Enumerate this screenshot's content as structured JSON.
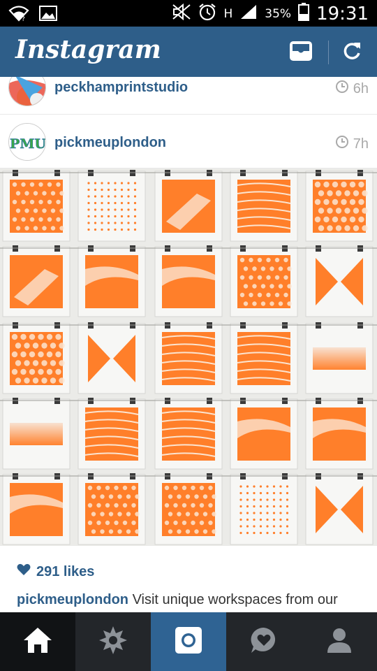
{
  "status_bar": {
    "battery": "35%",
    "network": "H",
    "time": "19:31",
    "icons": [
      "wifi-icon",
      "image-icon",
      "mute-icon",
      "alarm-icon",
      "signal-icon",
      "battery-icon"
    ]
  },
  "header": {
    "title": "Instagram",
    "actions": [
      "inbox-icon",
      "refresh-icon"
    ]
  },
  "feed": {
    "posts": [
      {
        "username": "peckhamprintstudio",
        "time": "6h"
      },
      {
        "username": "pickmeuplondon",
        "time": "7h",
        "avatar_text": "PMU",
        "likes": "291 likes",
        "caption_user": "pickmeuplondon",
        "caption_text": "Visit unique workspaces from our"
      }
    ]
  },
  "colors": {
    "accent": "#2e5e89",
    "print_orange": "#ff7f2a",
    "nav_bg": "#23262a"
  },
  "bottom_nav": [
    "home-icon",
    "explore-icon",
    "camera-icon",
    "activity-icon",
    "profile-icon"
  ]
}
